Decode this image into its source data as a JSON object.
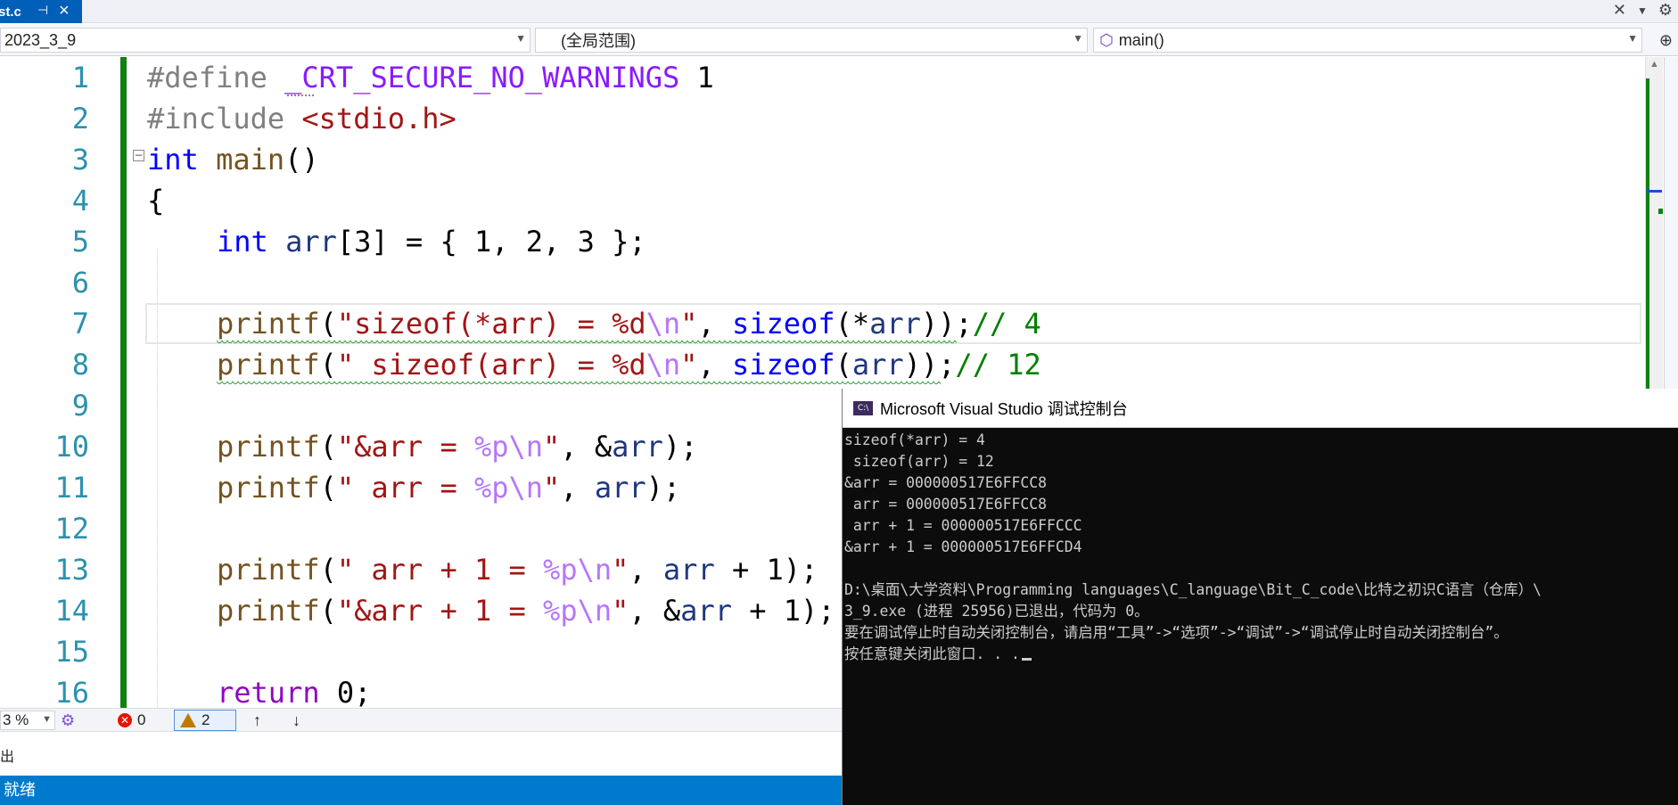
{
  "tab": {
    "filename": "st.c",
    "pin": "⊣",
    "close": "×"
  },
  "navbar": {
    "project": "2023_3_9",
    "scope": "(全局范围)",
    "function": "main()"
  },
  "code_lines": [
    {
      "n": "1"
    },
    {
      "n": "2"
    },
    {
      "n": "3"
    },
    {
      "n": "4"
    },
    {
      "n": "5"
    },
    {
      "n": "6"
    },
    {
      "n": "7"
    },
    {
      "n": "8"
    },
    {
      "n": "9"
    },
    {
      "n": "10"
    },
    {
      "n": "11"
    },
    {
      "n": "12"
    },
    {
      "n": "13"
    },
    {
      "n": "14"
    },
    {
      "n": "15"
    },
    {
      "n": "16"
    }
  ],
  "code": {
    "l1": {
      "a": "#define ",
      "b": "_CRT_SECURE_NO_WARNINGS",
      "c": " 1"
    },
    "l2": {
      "a": "#include ",
      "b": "<stdio.h>"
    },
    "l3": {
      "a": "int",
      "b": " ",
      "c": "main",
      "d": "()"
    },
    "l4": {
      "a": "{"
    },
    "l5": {
      "a": "int",
      "b": " ",
      "c": "arr",
      "d": "[3] = { 1, 2, 3 };"
    },
    "l7": {
      "a": "printf",
      "b": "(",
      "c": "\"sizeof(*arr) = %d",
      "d": "\\n",
      "e": "\"",
      "f": ", ",
      "g": "sizeof",
      "h": "(*",
      "i": "arr",
      "j": "));",
      "k": "// 4"
    },
    "l8": {
      "a": "printf",
      "b": "(",
      "c": "\" sizeof(arr) = %d",
      "d": "\\n",
      "e": "\"",
      "f": ", ",
      "g": "sizeof",
      "h": "(",
      "i": "arr",
      "j": "));",
      "k": "// 12"
    },
    "l10": {
      "a": "printf",
      "b": "(",
      "c": "\"&arr = ",
      "d": "%p",
      "e": "\\n",
      "f": "\"",
      "g": ", &",
      "h": "arr",
      "i": ");"
    },
    "l11": {
      "a": "printf",
      "b": "(",
      "c": "\" arr = ",
      "d": "%p",
      "e": "\\n",
      "f": "\"",
      "g": ", ",
      "h": "arr",
      "i": ");"
    },
    "l13": {
      "a": "printf",
      "b": "(",
      "c": "\" arr + 1 = ",
      "d": "%p",
      "e": "\\n",
      "f": "\"",
      "g": ", ",
      "h": "arr",
      "i": " + 1);"
    },
    "l14": {
      "a": "printf",
      "b": "(",
      "c": "\"&arr + 1 = ",
      "d": "%p",
      "e": "\\n",
      "f": "\"",
      "g": ", &",
      "h": "arr",
      "i": " + 1);"
    },
    "l16": {
      "a": "return",
      "b": " 0;"
    }
  },
  "statusstrip": {
    "zoom": "3 %",
    "errors": "0",
    "warnings": "2",
    "up": "↑",
    "down": "↓"
  },
  "output_label": "出",
  "statusbar": {
    "text": "就绪"
  },
  "console": {
    "title": "Microsoft Visual Studio 调试控制台",
    "lines": [
      "sizeof(*arr) = 4",
      " sizeof(arr) = 12",
      "&arr = 000000517E6FFCC8",
      " arr = 000000517E6FFCC8",
      " arr + 1 = 000000517E6FFCCC",
      "&arr + 1 = 000000517E6FFCD4",
      "",
      "D:\\桌面\\大学资料\\Programming languages\\C_language\\Bit_C_code\\比特之初识C语言（仓库）\\",
      "3_9.exe (进程 25956)已退出，代码为 0。",
      "要在调试停止时自动关闭控制台，请启用“工具”->“选项”->“调试”->“调试停止时自动关闭控制台”。",
      "按任意键关闭此窗口. . ."
    ]
  },
  "colors": {
    "accent": "#005fb8",
    "statusbar": "#007acc",
    "changebar": "#108010",
    "console_bg": "#0c0c0c"
  }
}
